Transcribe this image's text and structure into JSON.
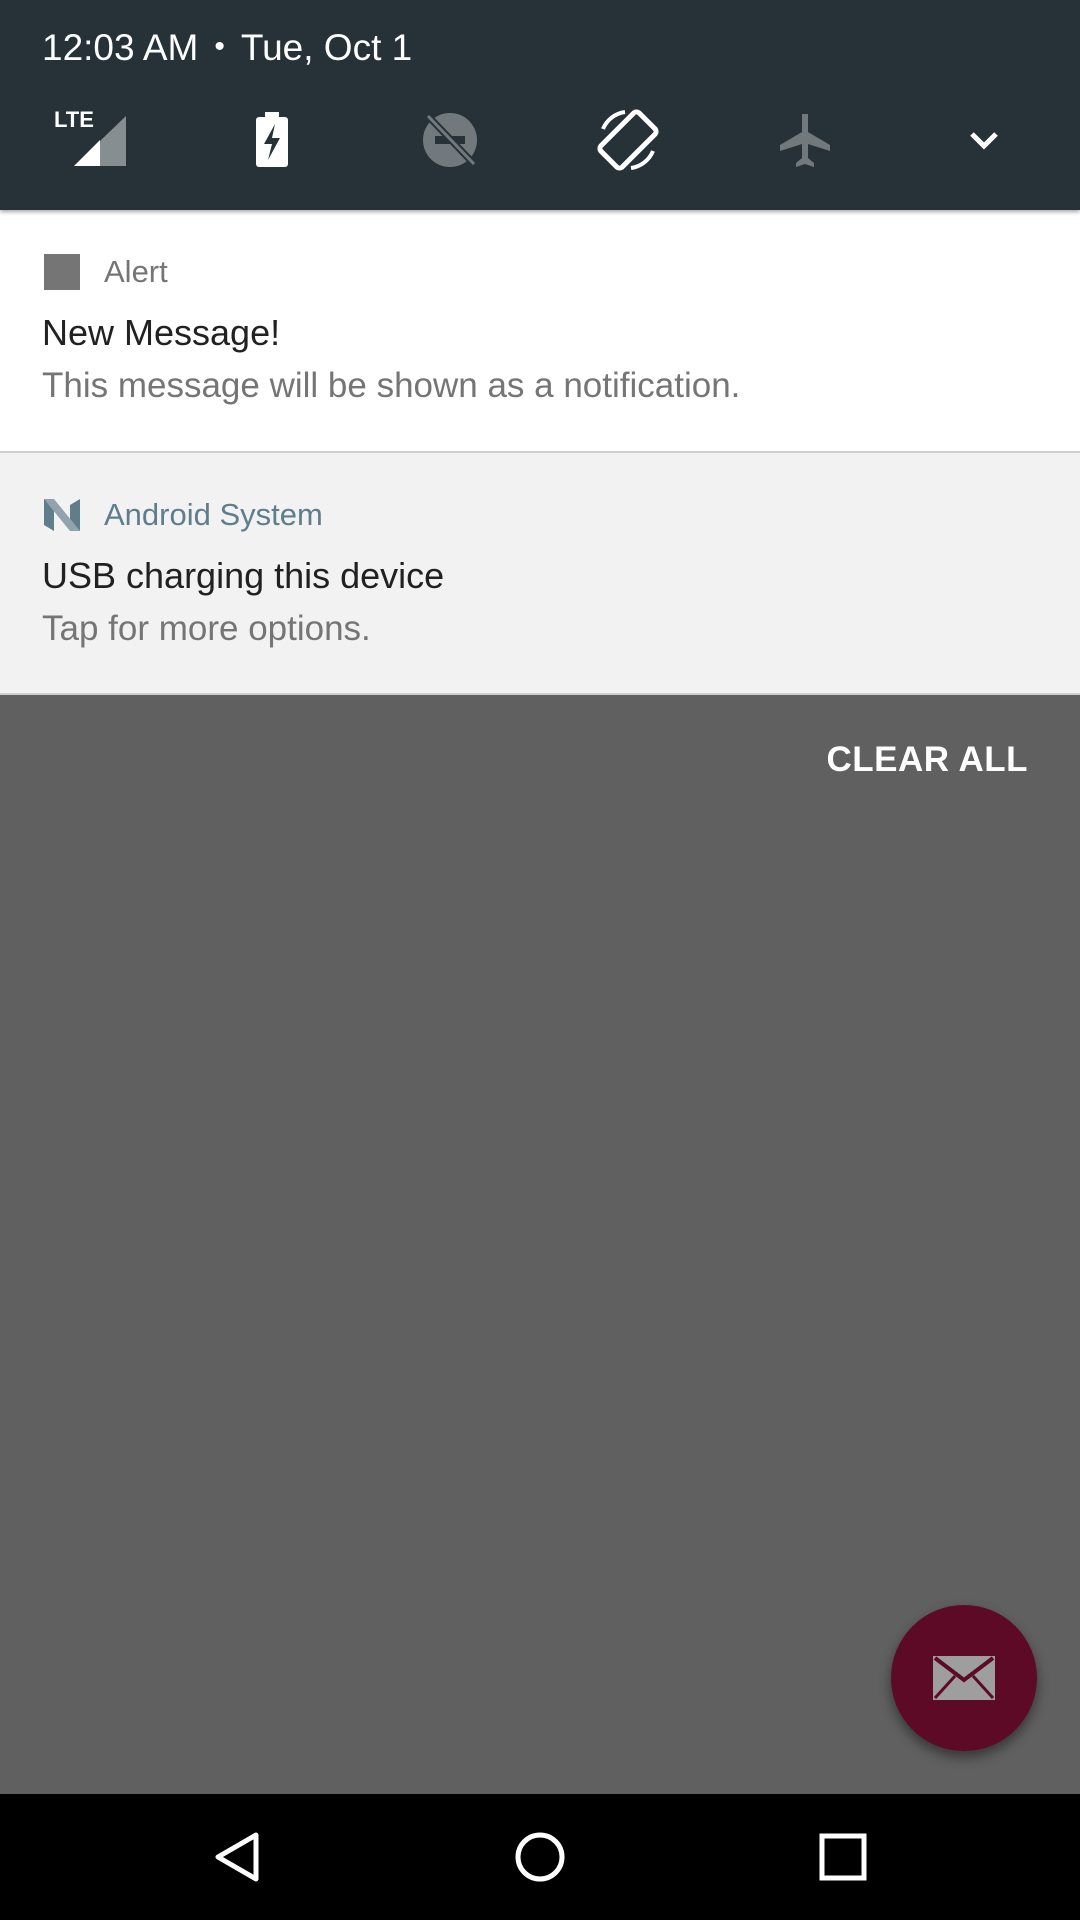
{
  "status": {
    "time": "12:03 AM",
    "separator": "•",
    "date": "Tue, Oct 1"
  },
  "quick_settings": {
    "tiles": [
      {
        "icon": "lte-signal-icon",
        "label": "LTE"
      },
      {
        "icon": "battery-saver-icon"
      },
      {
        "icon": "do-not-disturb-off-icon"
      },
      {
        "icon": "auto-rotate-icon"
      },
      {
        "icon": "airplane-mode-icon"
      },
      {
        "icon": "expand-chevron-icon"
      }
    ]
  },
  "notifications": [
    {
      "app_name": "Alert",
      "app_icon": "app-square-icon",
      "title": "New Message!",
      "text": "This message will be shown as a notification."
    },
    {
      "app_name": "Android System",
      "app_icon": "android-n-icon",
      "title": "USB charging this device",
      "text": "Tap for more options."
    }
  ],
  "clear_all_label": "CLEAR ALL",
  "fab": {
    "icon": "mail-icon",
    "color": "#5c0a26"
  },
  "navbar": {
    "buttons": [
      {
        "icon": "back-icon"
      },
      {
        "icon": "home-icon"
      },
      {
        "icon": "recents-icon"
      }
    ]
  },
  "colors": {
    "header_bg": "#263238",
    "scrim": "#606060",
    "system_app_accent": "#607d8b"
  }
}
